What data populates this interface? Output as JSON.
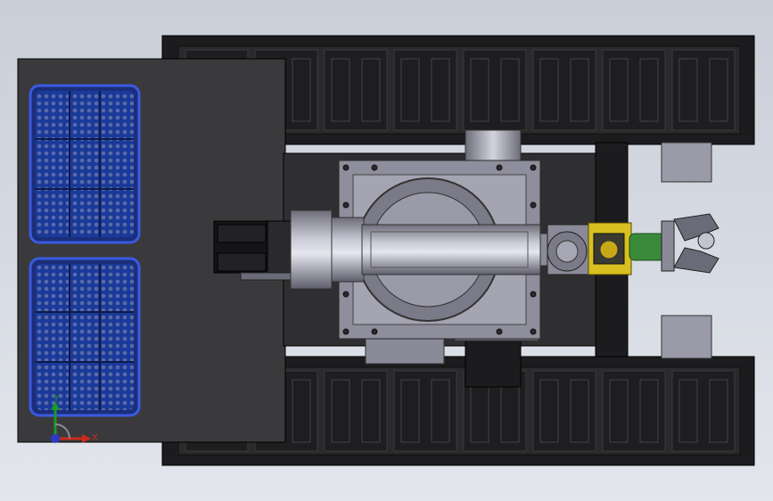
{
  "viewport": {
    "background_top": "#c9ced8",
    "background_bottom": "#e3e6ec"
  },
  "model": {
    "hull_color": "#2f2f31",
    "deck_color": "#3a3a3c",
    "track_color": "#1c1c1e",
    "metal_color": "#9a9aa8",
    "metal_dark": "#5e5e6c",
    "solar_panel_color": "#1a3a9a",
    "gripper_yellow": "#d8c020",
    "gripper_green": "#3a8a3a"
  },
  "triad": {
    "y_label": "Y",
    "x_label": "X",
    "y_color": "#1a9a2a",
    "x_color": "#cc2a1a",
    "z_color": "#2a3ac8",
    "icon": "coordinate-triad-icon"
  }
}
